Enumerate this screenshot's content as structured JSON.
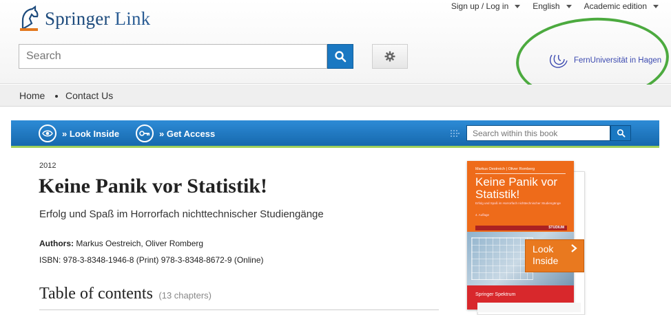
{
  "header": {
    "logo_brand": "Springer",
    "logo_light": " Link",
    "top_nav": [
      {
        "label": "Sign up / Log in"
      },
      {
        "label": "English"
      },
      {
        "label": "Academic edition"
      }
    ],
    "search_placeholder": "Search",
    "institution": "FernUniversität in Hagen"
  },
  "subnav": {
    "home": "Home",
    "contact": "Contact Us"
  },
  "action_bar": {
    "look_inside": "» Look Inside",
    "get_access": "» Get Access",
    "search_book_placeholder": "Search within this book"
  },
  "book": {
    "year": "2012",
    "title": "Keine Panik vor Statistik!",
    "subtitle": "Erfolg und Spaß im Horrorfach nichttechnischer Studiengänge",
    "authors_label": "Authors:",
    "authors": "Markus Oestreich, Oliver Romberg",
    "isbn": "ISBN: 978-3-8348-1946-8 (Print) 978-3-8348-8672-9 (Online)",
    "toc_heading": "Table of contents",
    "toc_count": "(13 chapters)"
  },
  "cover": {
    "authors": "Markus Oestreich | Oliver Romberg",
    "title": "Keine Panik vor Statistik!",
    "subtitle": "Erfolg und Spaß im Horrorfach nichttechnischer Studiengänge",
    "edition": "4. Auflage",
    "badge": "STUDIUM",
    "publisher": "Springer Spektrum",
    "look_inside": "Look Inside"
  },
  "colors": {
    "brand_blue": "#1c4a7c",
    "action_bar_blue": "#1a78c2",
    "highlight_green": "#4caa3f",
    "cover_orange": "#ee6b1a"
  }
}
